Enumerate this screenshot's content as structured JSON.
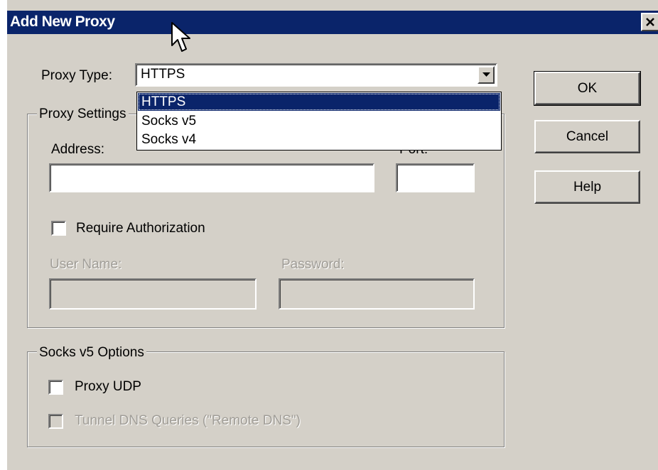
{
  "window": {
    "title": "Add New Proxy",
    "close_glyph": "×"
  },
  "proxy_type": {
    "label": "Proxy Type:",
    "value": "HTTPS",
    "options": [
      "HTTPS",
      "Socks v5",
      "Socks v4"
    ],
    "selected_option": "HTTPS"
  },
  "proxy_settings": {
    "group_title": "Proxy Settings",
    "address_label": "Address:",
    "address_value": "",
    "port_label": "Port:",
    "port_value": "",
    "require_auth_label": "Require Authorization",
    "require_auth_checked": false,
    "username_label": "User Name:",
    "username_value": "",
    "password_label": "Password:",
    "password_value": ""
  },
  "socks_v5_options": {
    "group_title": "Socks v5 Options",
    "proxy_udp_label": "Proxy UDP",
    "proxy_udp_checked": false,
    "tunnel_dns_label": "Tunnel DNS Queries (\"Remote DNS\")",
    "tunnel_dns_checked": false
  },
  "buttons": {
    "ok": "OK",
    "cancel": "Cancel",
    "help": "Help"
  },
  "colors": {
    "titlebar": "#0a246a",
    "dialog_face": "#d4d0c8",
    "selection": "#0a246a",
    "disabled_text": "#a09d97"
  },
  "icons": {
    "close": "close-icon",
    "dropdown_arrow": "chevron-down-icon",
    "cursor": "mouse-pointer-icon"
  }
}
